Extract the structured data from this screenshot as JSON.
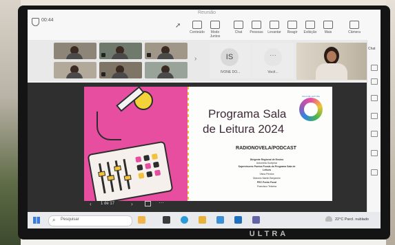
{
  "window": {
    "title": "Reunião",
    "timer": "00:44"
  },
  "toolbar": {
    "items": [
      {
        "label": "Conteúdo"
      },
      {
        "label": "Modo Juntos"
      },
      {
        "label": "Chat"
      },
      {
        "label": "Pessoas"
      },
      {
        "label": "Levantar"
      },
      {
        "label": "Reagir"
      },
      {
        "label": "Exibição"
      },
      {
        "label": "Mais"
      },
      {
        "label": "Câmera"
      }
    ]
  },
  "participants": {
    "tile_is": {
      "initials": "IS",
      "label": "IVONE DO..."
    },
    "tile_more": {
      "label": "Você..."
    }
  },
  "side_panel": {
    "title": "Chat"
  },
  "slide": {
    "title_line1": "Programa Sala",
    "title_line2": "de Leitura 2024",
    "logo_text": "SALA DE LEITURA",
    "subtitle": "RADIONOVELA/PODCAST",
    "credits": [
      {
        "text": "Dirigente Regional de Ensino",
        "bold": true
      },
      {
        "text": "Antonieta Guelphar",
        "bold": false
      },
      {
        "text": "Supervisores Pontos Focais do Programa Sala de",
        "bold": true
      },
      {
        "text": "Leitura",
        "bold": true
      },
      {
        "text": "Vilma Pereira",
        "bold": false
      },
      {
        "text": "Marcelo Martin Benjamim",
        "bold": false
      },
      {
        "text": "PEC Ponto Focal",
        "bold": true
      },
      {
        "text": "Francisco Teixeira",
        "bold": false
      }
    ]
  },
  "slide_controls": {
    "page_indicator": "1 de 17",
    "prev": "‹",
    "next": "›",
    "more": "···"
  },
  "taskbar": {
    "search_placeholder": "Pesquisar",
    "weather": "22°C Parcl. nublado"
  },
  "monitor": {
    "brand": "ULTRA"
  },
  "colors": {
    "slide_pink": "#e84ea0",
    "slide_yellow": "#f1c232",
    "title": "#3f2a3a"
  }
}
